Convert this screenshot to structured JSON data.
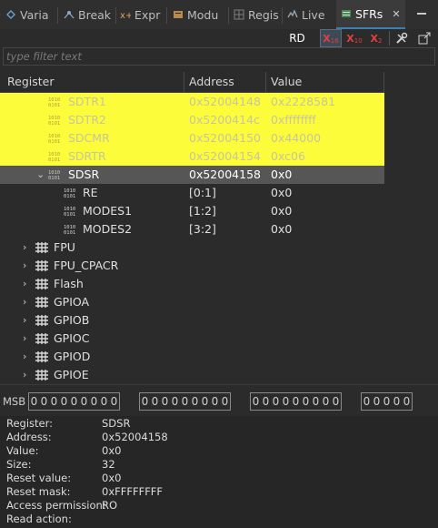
{
  "tabs": [
    {
      "label": "Varia",
      "icon": "variables-icon"
    },
    {
      "label": "Break",
      "icon": "breakpoints-icon"
    },
    {
      "label": "Expr",
      "icon": "expressions-icon"
    },
    {
      "label": "Modu",
      "icon": "modules-icon"
    },
    {
      "label": "Regis",
      "icon": "registers-icon"
    },
    {
      "label": "Live",
      "icon": "live-expressions-icon"
    },
    {
      "label": "SFRs",
      "icon": "sfrs-icon",
      "close": "✕"
    }
  ],
  "toolbar": {
    "rd_label": "RD",
    "hex_label": "X",
    "hex_sub": "16",
    "dec_label": "X",
    "dec_sub": "10",
    "bin_label": "X",
    "bin_sub": "2"
  },
  "filter": {
    "placeholder": "type filter text"
  },
  "columns": {
    "register": "Register",
    "address": "Address",
    "value": "Value"
  },
  "rows": [
    {
      "name": "SDTR1",
      "address": "0x52004148",
      "value": "0x2228581",
      "state": "highlighted"
    },
    {
      "name": "SDTR2",
      "address": "0x5200414c",
      "value": "0xffffffff",
      "state": "highlighted"
    },
    {
      "name": "SDCMR",
      "address": "0x52004150",
      "value": "0x44000",
      "state": "highlighted"
    },
    {
      "name": "SDRTR",
      "address": "0x52004154",
      "value": "0xc06",
      "state": "highlighted"
    },
    {
      "name": "SDSR",
      "address": "0x52004158",
      "value": "0x0",
      "state": "selected",
      "expanded": true
    },
    {
      "name": "RE",
      "address": "[0:1]",
      "value": "0x0",
      "state": "field"
    },
    {
      "name": "MODES1",
      "address": "[1:2]",
      "value": "0x0",
      "state": "field"
    },
    {
      "name": "MODES2",
      "address": "[3:2]",
      "value": "0x0",
      "state": "field"
    },
    {
      "name": "FPU",
      "address": "",
      "value": "",
      "state": "peripheral"
    },
    {
      "name": "FPU_CPACR",
      "address": "",
      "value": "",
      "state": "peripheral"
    },
    {
      "name": "Flash",
      "address": "",
      "value": "",
      "state": "peripheral"
    },
    {
      "name": "GPIOA",
      "address": "",
      "value": "",
      "state": "peripheral"
    },
    {
      "name": "GPIOB",
      "address": "",
      "value": "",
      "state": "peripheral"
    },
    {
      "name": "GPIOC",
      "address": "",
      "value": "",
      "state": "peripheral"
    },
    {
      "name": "GPIOD",
      "address": "",
      "value": "",
      "state": "peripheral"
    },
    {
      "name": "GPIOE",
      "address": "",
      "value": "",
      "state": "peripheral"
    }
  ],
  "bits": {
    "msb_label": "MSB",
    "groups": [
      [
        "0",
        "0",
        "0",
        "0",
        "0",
        "0",
        "0",
        "0",
        "0"
      ],
      [
        "0",
        "0",
        "0",
        "0",
        "0",
        "0",
        "0",
        "0",
        "0"
      ],
      [
        "0",
        "0",
        "0",
        "0",
        "0",
        "0",
        "0",
        "0",
        "0"
      ],
      [
        "0",
        "0",
        "0",
        "0",
        "0"
      ]
    ]
  },
  "details": [
    {
      "label": "Register:",
      "value": "SDSR"
    },
    {
      "label": "Address:",
      "value": "0x52004158"
    },
    {
      "label": "Value:",
      "value": "0x0"
    },
    {
      "label": "Size:",
      "value": "32"
    },
    {
      "label": "Reset value:",
      "value": "0x0"
    },
    {
      "label": "Reset mask:",
      "value": "0xFFFFFFFF"
    },
    {
      "label": "Access permission:",
      "value": "RO"
    },
    {
      "label": "Read action:",
      "value": ""
    }
  ],
  "colors": {
    "highlight": "#fcfc3a",
    "selected": "#565656",
    "accent": "#3c7fb1"
  }
}
